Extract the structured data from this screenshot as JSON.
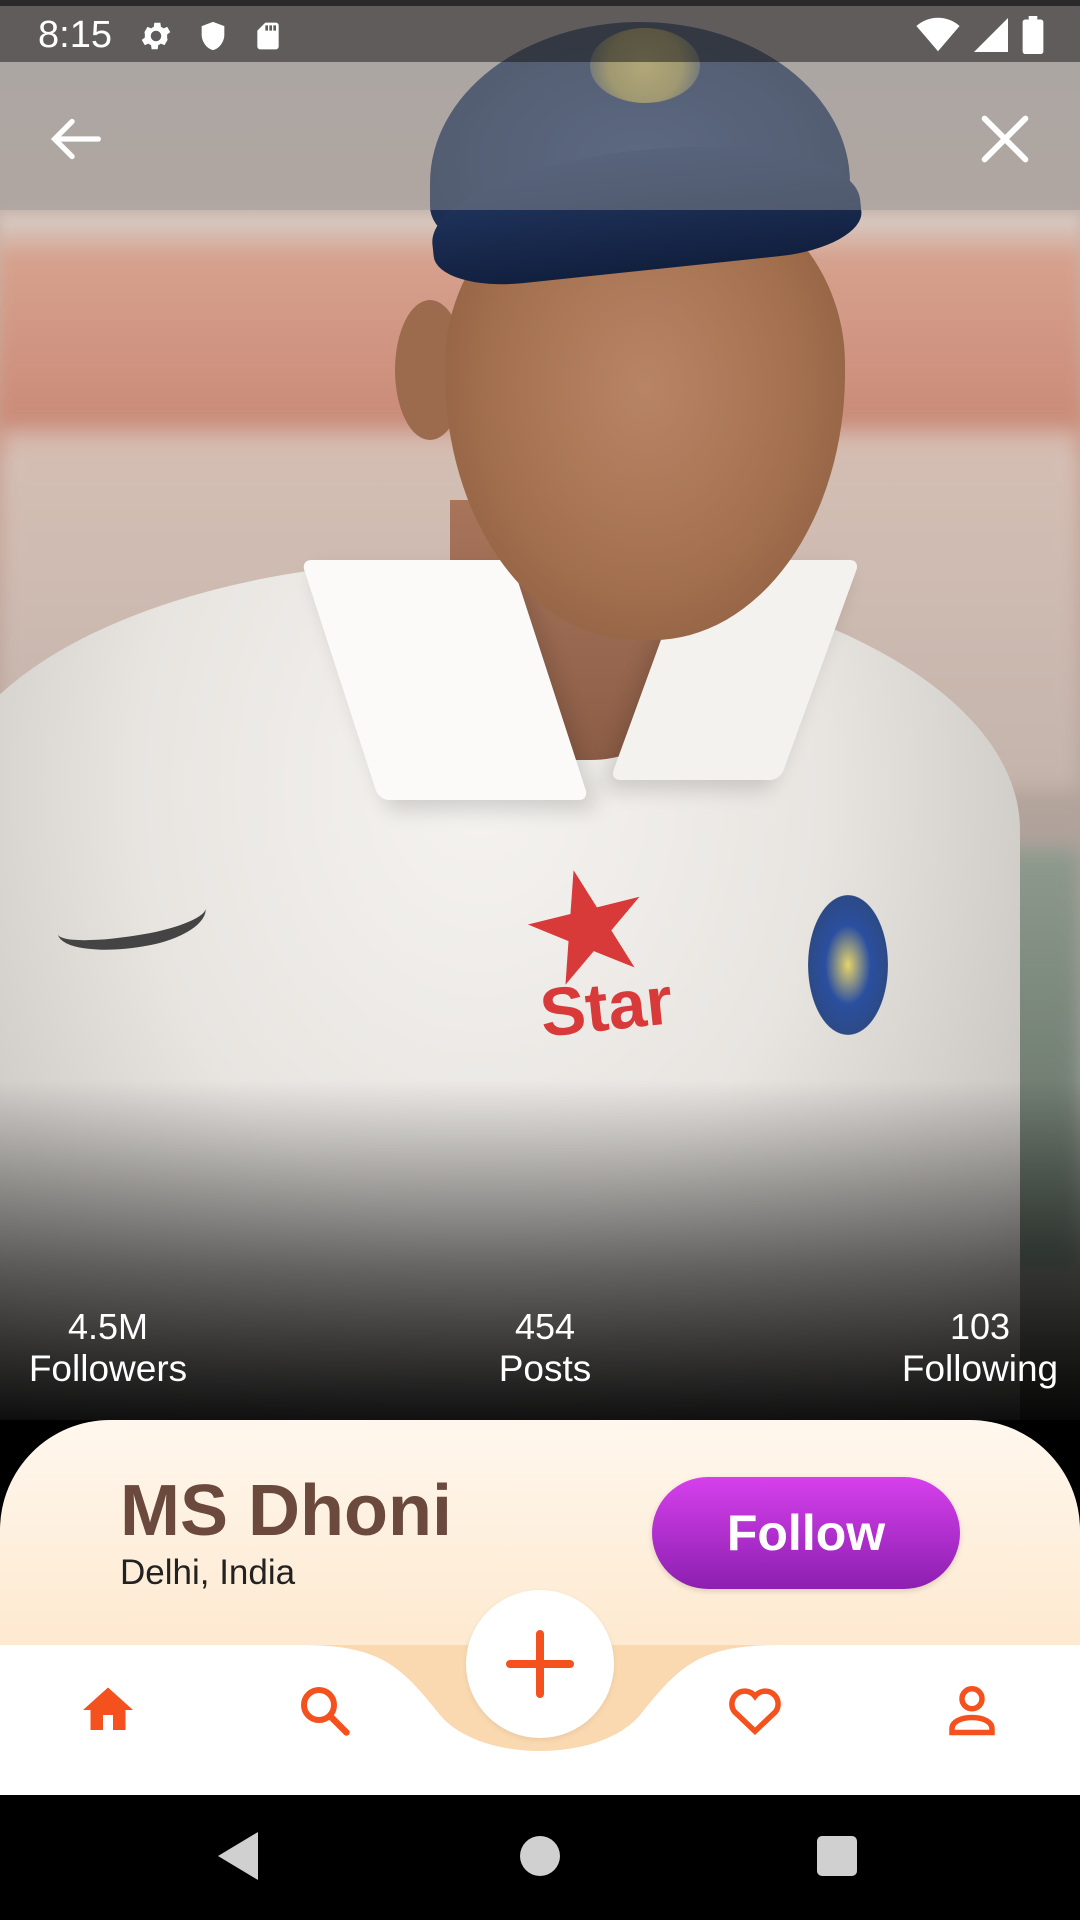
{
  "status_bar": {
    "time": "8:15",
    "left_icons": [
      "settings-icon",
      "shield-icon",
      "sd-card-icon"
    ],
    "right_icons": [
      "wifi-icon",
      "signal-icon",
      "battery-icon"
    ]
  },
  "app_bar": {
    "back_icon": "arrow-back-icon",
    "close_icon": "close-icon"
  },
  "stats": {
    "followers": {
      "value": "4.5M",
      "label": "Followers"
    },
    "posts": {
      "value": "454",
      "label": "Posts"
    },
    "following": {
      "value": "103",
      "label": "Following"
    }
  },
  "profile": {
    "name": "MS Dhoni",
    "location": "Delhi, India",
    "follow_label": "Follow"
  },
  "photo": {
    "sponsor_text": "Star"
  },
  "bottom_nav": {
    "items": [
      {
        "icon": "home-icon",
        "active": true
      },
      {
        "icon": "search-icon",
        "active": false
      },
      {
        "icon": "add-icon",
        "active": false
      },
      {
        "icon": "heart-icon",
        "active": false
      },
      {
        "icon": "person-icon",
        "active": false
      }
    ]
  },
  "colors": {
    "accent": "#f4511e",
    "name_text": "#6b4a3d",
    "follow_gradient_top": "#d640ec",
    "follow_gradient_bottom": "#8c1fb0",
    "card_top": "#fff7ee",
    "card_bottom": "#fde6c8"
  }
}
